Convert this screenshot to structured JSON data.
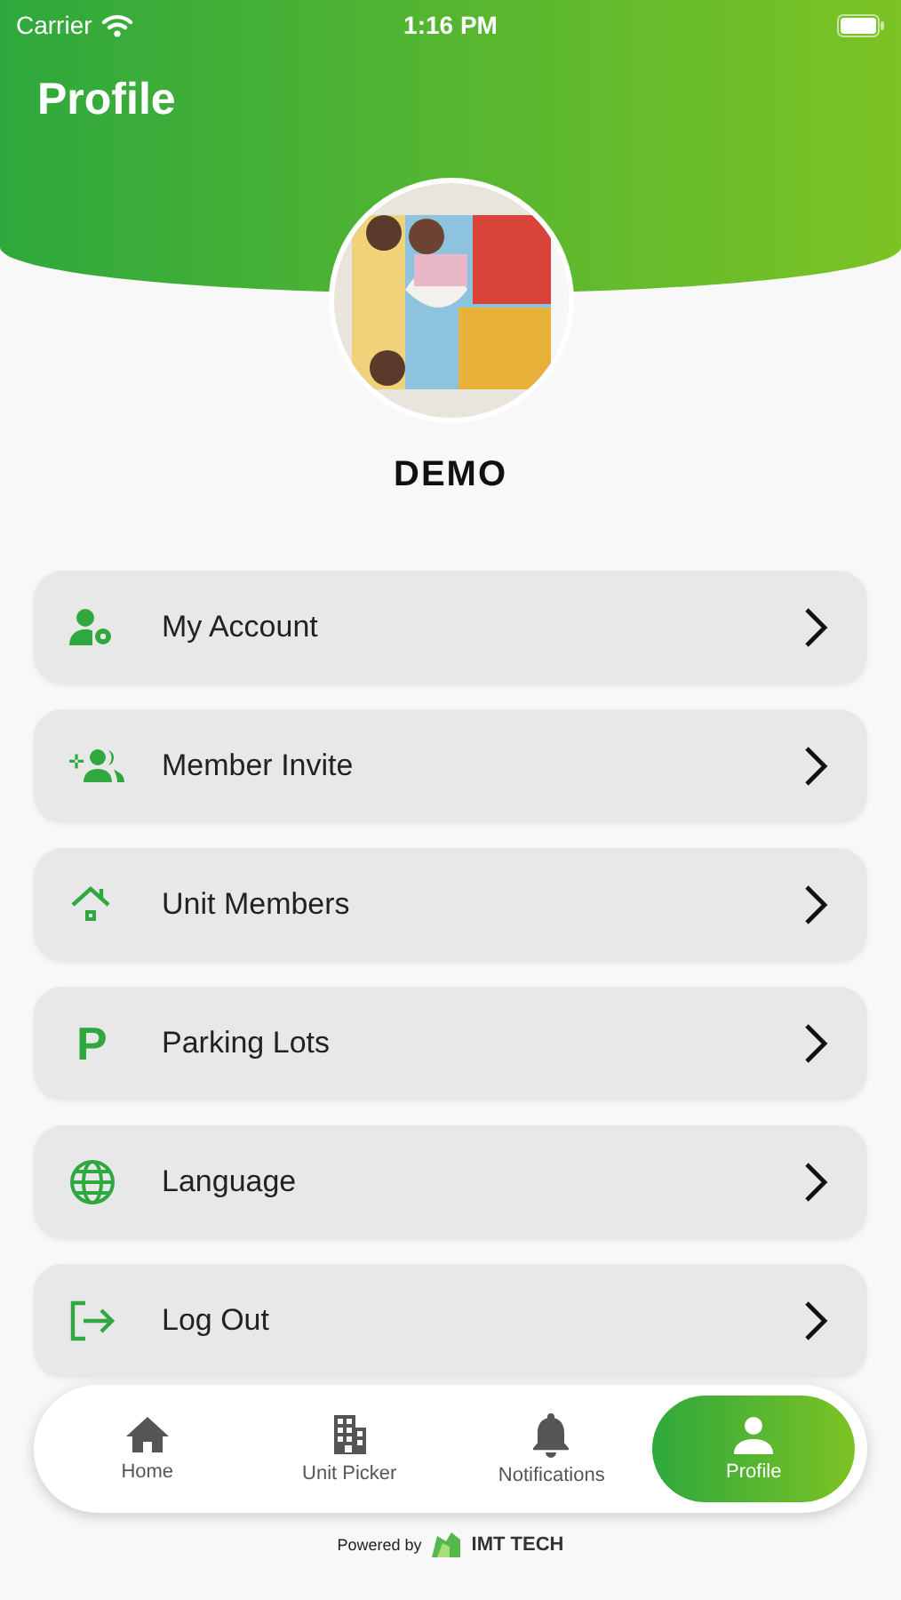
{
  "status_bar": {
    "carrier": "Carrier",
    "time": "1:16 PM"
  },
  "header": {
    "title": "Profile"
  },
  "profile": {
    "name": "DEMO"
  },
  "menu": [
    {
      "kind": "account",
      "label": "My Account"
    },
    {
      "kind": "invite",
      "label": "Member Invite"
    },
    {
      "kind": "members",
      "label": "Unit Members"
    },
    {
      "kind": "parking",
      "label": "Parking Lots",
      "icon_text": "P"
    },
    {
      "kind": "language",
      "label": "Language"
    },
    {
      "kind": "logout",
      "label": "Log Out"
    }
  ],
  "bottom_nav": [
    {
      "kind": "home",
      "label": "Home",
      "selected": false
    },
    {
      "kind": "building",
      "label": "Unit Picker",
      "selected": false
    },
    {
      "kind": "bell",
      "label": "Notifications",
      "selected": false
    },
    {
      "kind": "person",
      "label": "Profile",
      "selected": true
    }
  ],
  "footer": {
    "powered_by": "Powered by",
    "brand": "IMT TECH"
  }
}
